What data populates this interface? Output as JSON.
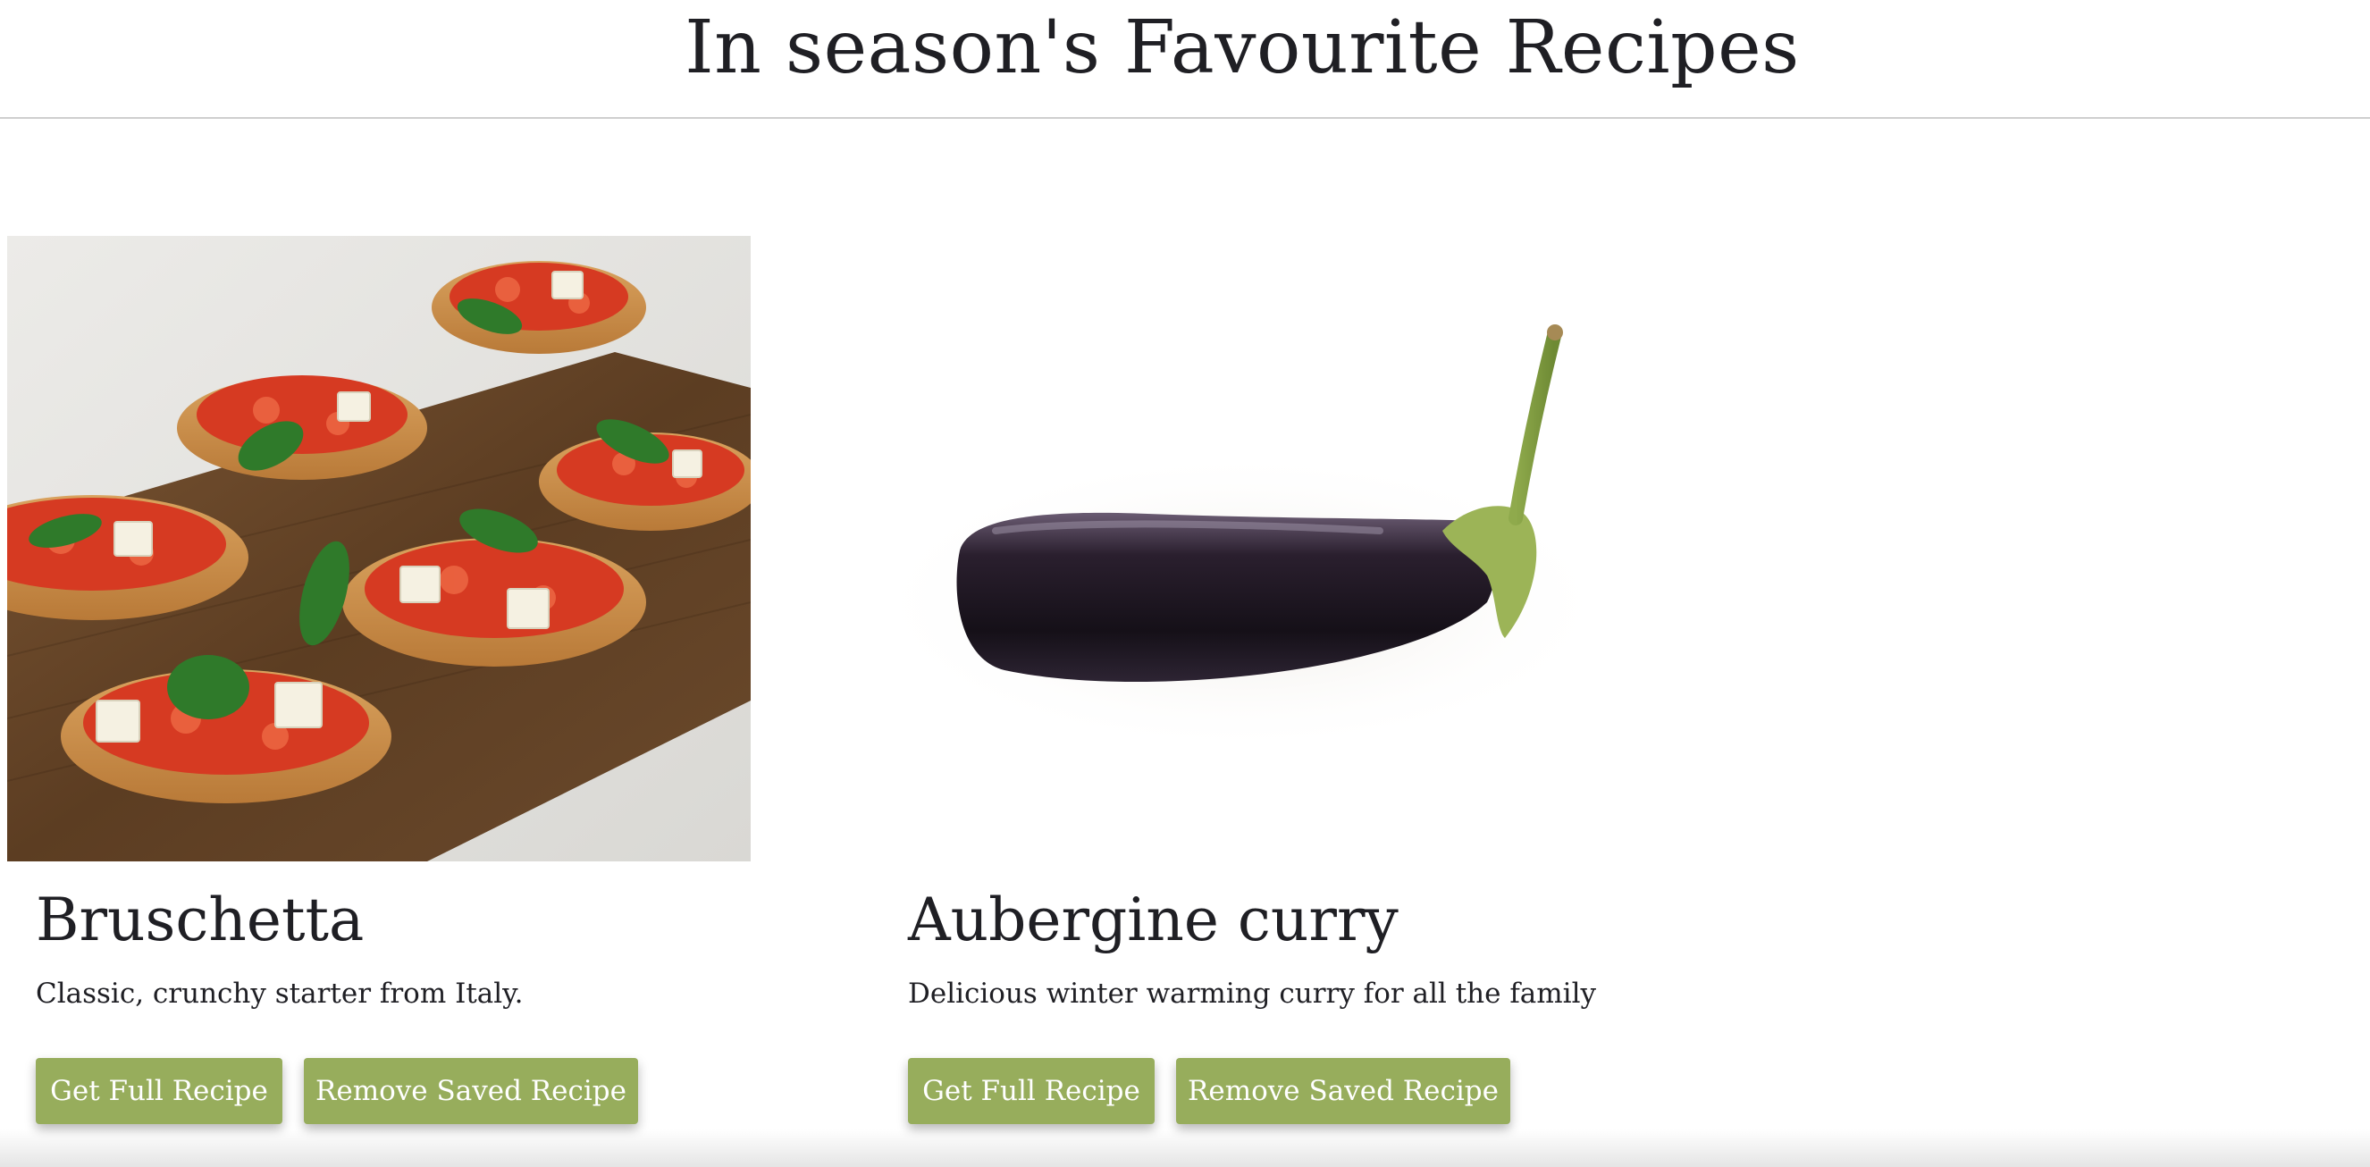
{
  "header": {
    "title": "In season's Favourite Recipes"
  },
  "recipes": [
    {
      "image_icon": "bruschetta-photo",
      "title": "Bruschetta",
      "description": "Classic, crunchy starter from Italy.",
      "primary_button": "Get Full Recipe",
      "secondary_button": "Remove Saved Recipe"
    },
    {
      "image_icon": "aubergine-photo",
      "title": "Aubergine curry",
      "description": "Delicious winter warming curry for all the family",
      "primary_button": "Get Full Recipe",
      "secondary_button": "Remove Saved Recipe"
    }
  ],
  "colors": {
    "button_bg": "#97ad5c",
    "button_text": "#ffffff",
    "text": "#1f1f24",
    "divider": "#cfcfcf"
  }
}
